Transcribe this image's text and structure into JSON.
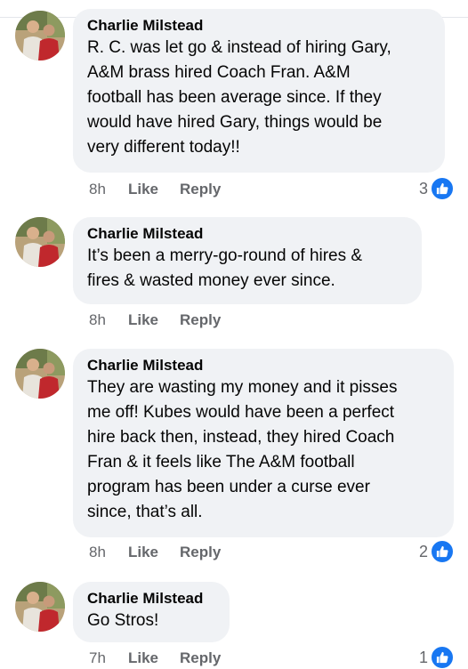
{
  "accent_color": "#1877f2",
  "comments": [
    {
      "author": "Charlie Milstead",
      "text": "R. C. was let go & instead of hiring Gary,\nA&M brass hired Coach Fran. A&M\nfootball has been average since. If they\nwould have hired Gary, things would be\nvery different today!!",
      "time": "8h",
      "like_label": "Like",
      "reply_label": "Reply",
      "reactions": "3",
      "reaction_icon": "thumbs-up-icon"
    },
    {
      "author": "Charlie Milstead",
      "text": "It’s been a merry-go-round of hires &\nfires & wasted money ever since.",
      "time": "8h",
      "like_label": "Like",
      "reply_label": "Reply",
      "reactions": ""
    },
    {
      "author": "Charlie Milstead",
      "text": "They are wasting my money and it pisses\nme off! Kubes would have been a perfect\nhire back then, instead, they hired Coach\nFran & it feels like The A&M football\nprogram has been under a curse ever\nsince, that’s all.",
      "time": "8h",
      "like_label": "Like",
      "reply_label": "Reply",
      "reactions": "2",
      "reaction_icon": "thumbs-up-icon"
    },
    {
      "author": "Charlie Milstead",
      "text": "Go Stros!",
      "time": "7h",
      "like_label": "Like",
      "reply_label": "Reply",
      "reactions": "1",
      "reaction_icon": "thumbs-up-icon"
    }
  ]
}
